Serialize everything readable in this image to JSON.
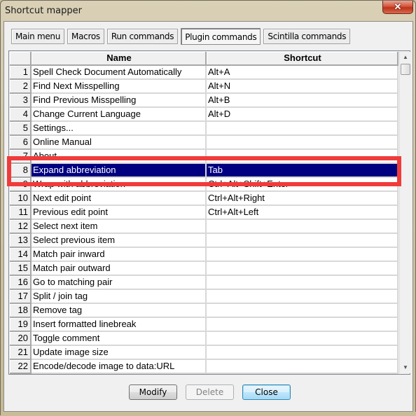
{
  "window": {
    "title": "Shortcut mapper",
    "close_glyph": "✕"
  },
  "tabs": [
    {
      "label": "Main menu",
      "active": false
    },
    {
      "label": "Macros",
      "active": false
    },
    {
      "label": "Run commands",
      "active": false
    },
    {
      "label": "Plugin commands",
      "active": true
    },
    {
      "label": "Scintilla commands",
      "active": false
    }
  ],
  "grid": {
    "columns": {
      "num": "",
      "name": "Name",
      "shortcut": "Shortcut"
    },
    "selected_row": 8,
    "rows": [
      {
        "num": "1",
        "name": "Spell Check Document Automatically",
        "shortcut": "Alt+A"
      },
      {
        "num": "2",
        "name": "Find Next Misspelling",
        "shortcut": "Alt+N"
      },
      {
        "num": "3",
        "name": "Find Previous Misspelling",
        "shortcut": "Alt+B"
      },
      {
        "num": "4",
        "name": "Change Current Language",
        "shortcut": "Alt+D"
      },
      {
        "num": "5",
        "name": "Settings...",
        "shortcut": ""
      },
      {
        "num": "6",
        "name": "Online Manual",
        "shortcut": ""
      },
      {
        "num": "7",
        "name": "About",
        "shortcut": ""
      },
      {
        "num": "8",
        "name": "Expand abbreviation",
        "shortcut": "Tab"
      },
      {
        "num": "9",
        "name": "Wrap with abbreviation",
        "shortcut": "Ctrl+Alt+Shift+Enter"
      },
      {
        "num": "10",
        "name": "Next edit point",
        "shortcut": "Ctrl+Alt+Right"
      },
      {
        "num": "11",
        "name": "Previous edit point",
        "shortcut": "Ctrl+Alt+Left"
      },
      {
        "num": "12",
        "name": "Select next item",
        "shortcut": ""
      },
      {
        "num": "13",
        "name": "Select previous item",
        "shortcut": ""
      },
      {
        "num": "14",
        "name": "Match pair inward",
        "shortcut": ""
      },
      {
        "num": "15",
        "name": "Match pair outward",
        "shortcut": ""
      },
      {
        "num": "16",
        "name": "Go to matching pair",
        "shortcut": ""
      },
      {
        "num": "17",
        "name": "Split / join tag",
        "shortcut": ""
      },
      {
        "num": "18",
        "name": "Remove tag",
        "shortcut": ""
      },
      {
        "num": "19",
        "name": "Insert formatted linebreak",
        "shortcut": ""
      },
      {
        "num": "20",
        "name": "Toggle comment",
        "shortcut": ""
      },
      {
        "num": "21",
        "name": "Update image size",
        "shortcut": ""
      },
      {
        "num": "22",
        "name": "Encode/decode image to data:URL",
        "shortcut": ""
      }
    ]
  },
  "scrollbar": {
    "up_glyph": "▲",
    "down_glyph": "▼"
  },
  "buttons": {
    "modify": {
      "label": "Modify",
      "enabled": true
    },
    "delete": {
      "label": "Delete",
      "enabled": false
    },
    "close": {
      "label": "Close",
      "enabled": true,
      "default": true
    }
  },
  "annotation": {
    "highlight_color": "#f03b3b",
    "highlighted_row": 8
  },
  "colors": {
    "selection": "#000080"
  }
}
